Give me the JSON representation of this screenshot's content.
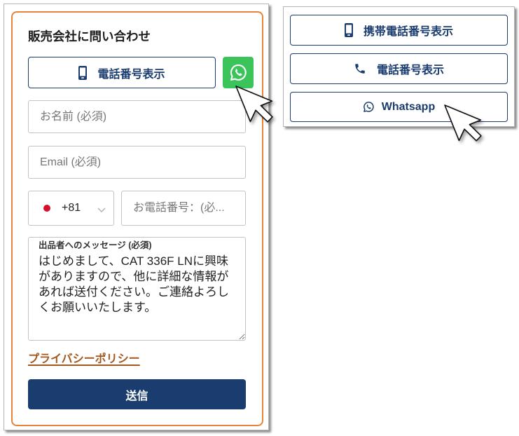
{
  "contact_form": {
    "title": "販売会社に問い合わせ",
    "show_phone_button": {
      "label": "電話番号表示",
      "icon": "mobile-phone-icon"
    },
    "whatsapp_button": {
      "icon": "whatsapp-icon"
    },
    "name_field": {
      "placeholder": "お名前 (必須)"
    },
    "email_field": {
      "placeholder": "Email (必須)"
    },
    "country_code": {
      "flag_icon": "japan-flag-icon",
      "value": "+81",
      "dropdown_icon": "chevron-down-icon"
    },
    "phone_field": {
      "placeholder": "お電話番号：(必..."
    },
    "message": {
      "label": "出品者へのメッセージ (必須)",
      "value": "はじめまして、CAT 336F LNに興味がありますので、他に詳細な情報があれば送付ください。ご連絡よろしくお願いいたします。"
    },
    "privacy_link": "プライバシーポリシー",
    "submit_label": "送信"
  },
  "contact_options": {
    "buttons": [
      {
        "label": "携帯電話番号表示",
        "icon": "mobile-phone-icon"
      },
      {
        "label": "電話番号表示",
        "icon": "phone-icon"
      },
      {
        "label": "Whatsapp",
        "icon": "whatsapp-icon"
      }
    ]
  },
  "pointer": {
    "icon": "mouse-cursor-icon"
  },
  "colors": {
    "navy": "#1b3c6e",
    "orange_border": "#e8833a",
    "whatsapp_green": "#3ac45a",
    "link": "#a4571c"
  }
}
